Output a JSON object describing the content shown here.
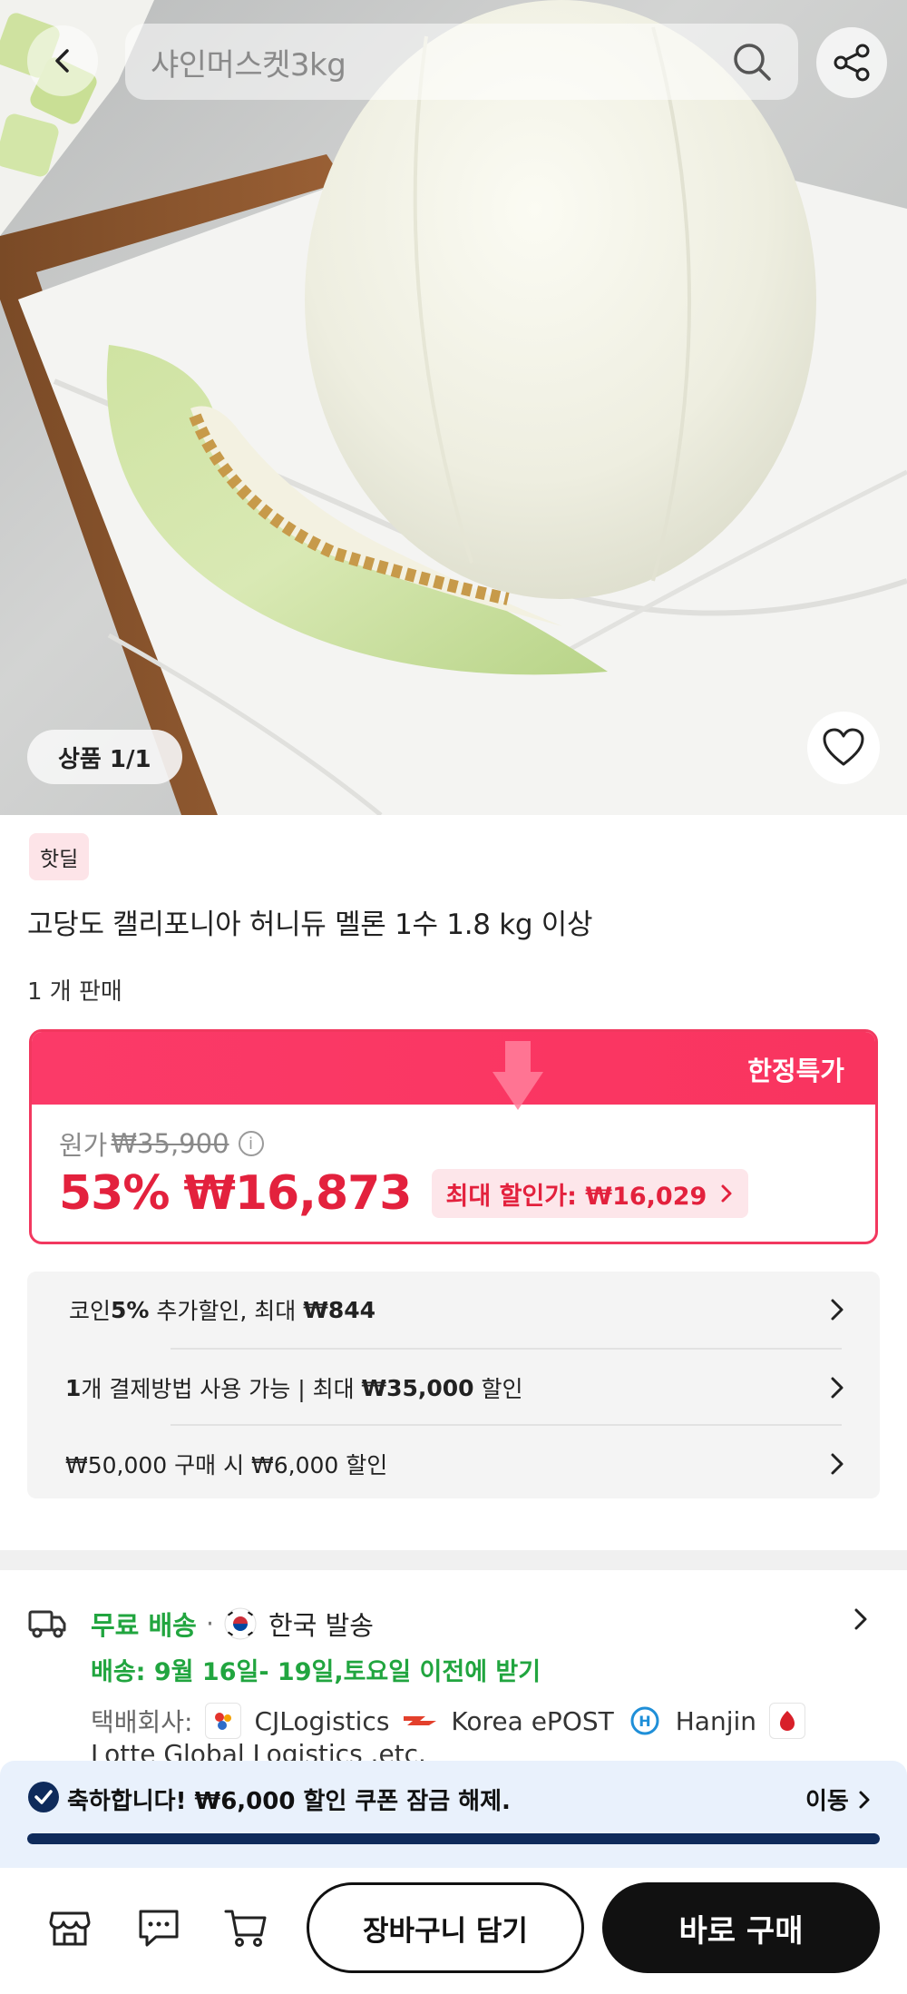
{
  "header": {
    "search_placeholder": "샤인머스켓3kg",
    "back_icon": "chevron-left-icon",
    "search_icon": "search-icon",
    "share_icon": "share-icon"
  },
  "gallery": {
    "counter": "상품 1/1",
    "wishlist_icon": "heart-icon"
  },
  "product": {
    "badge": "핫딜",
    "title": "고당도 캘리포니아 허니듀 멜론 1수 1.8 kg 이상",
    "sold": "1 개 판매"
  },
  "price": {
    "banner_label": "한정특가",
    "original_label": "원가",
    "original_price": "₩35,900",
    "discount_pct": "53%",
    "sale_price": "₩16,873",
    "max_discount": "최대 할인가: ₩16,029",
    "accent_color": "#f9345f",
    "sale_color": "#e3213d"
  },
  "benefits": {
    "coin_prefix": "코인 ",
    "coin_pct": "5%",
    "coin_mid": " 추가할인, 최대 ",
    "coin_max": "₩844",
    "payment_count": "1",
    "payment_mid": "개 결제방법 사용 가능 | 최대 ",
    "payment_max": "₩35,000",
    "payment_suffix": " 할인",
    "bundle": "₩50,000 구매 시 ₩6,000 할인"
  },
  "shipping": {
    "free": "무료 배송",
    "separator": "·",
    "origin": "한국 발송",
    "delivery": "배송: 9월 16일- 19일,토요일 이전에 받기",
    "courier_label": "택배회사:",
    "couriers": [
      "CJLogistics",
      "Korea ePOST",
      "Hanjin"
    ],
    "courier_more": "Lotte Global Logistics .etc.",
    "free_color": "#21a53f"
  },
  "coupon": {
    "message_prefix": "축하합니다! ",
    "message_amount": "₩6,000",
    "message_suffix": " 할인 쿠폰 잠금 해제.",
    "action": "이동",
    "progress_pct": 100
  },
  "bottom_bar": {
    "store_icon": "store-icon",
    "chat_icon": "chat-icon",
    "cart_icon": "cart-icon",
    "add_to_cart": "장바구니 담기",
    "buy_now": "바로 구매"
  }
}
